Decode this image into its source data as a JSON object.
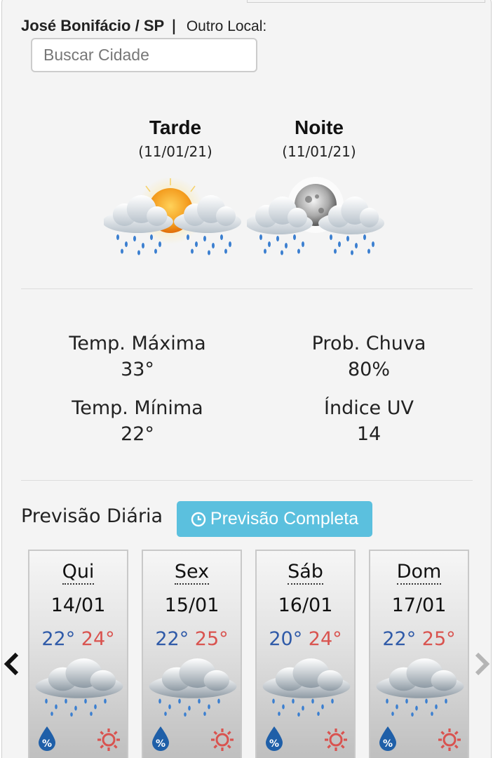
{
  "location": {
    "name": "José Bonifácio / SP",
    "separator": "|",
    "other_label": "Outro Local:",
    "search_placeholder": "Buscar Cidade"
  },
  "periods": [
    {
      "title": "Tarde",
      "date": "(11/01/21)",
      "icon": "sun-cloud-rain-icon"
    },
    {
      "title": "Noite",
      "date": "(11/01/21)",
      "icon": "moon-cloud-rain-icon"
    }
  ],
  "stats": {
    "max_label": "Temp. Máxima",
    "max_value": "33°",
    "min_label": "Temp. Mínima",
    "min_value": "22°",
    "rain_label": "Prob. Chuva",
    "rain_value": "80%",
    "uv_label": "Índice UV",
    "uv_value": "14"
  },
  "daily": {
    "title": "Previsão Diária",
    "full_button": "Previsão Completa",
    "days": [
      {
        "name": "Qui",
        "date": "14/01",
        "min": "22°",
        "max": "24°"
      },
      {
        "name": "Sex",
        "date": "15/01",
        "min": "22°",
        "max": "25°"
      },
      {
        "name": "Sáb",
        "date": "16/01",
        "min": "20°",
        "max": "24°"
      },
      {
        "name": "Dom",
        "date": "17/01",
        "min": "22°",
        "max": "25°"
      }
    ]
  },
  "colors": {
    "button": "#5bc0de",
    "min_temp": "#2f5aa8",
    "max_temp": "#d9534f",
    "rain_drop": "#1f5fa8",
    "uv_sun": "#d9534f"
  },
  "icons": {
    "prev": "chevron-left-icon",
    "next": "chevron-right-icon",
    "clock": "clock-icon",
    "rain_probability": "rain-drop-percent-icon",
    "uv": "sun-outline-icon",
    "day_weather": "cloud-rain-icon"
  }
}
